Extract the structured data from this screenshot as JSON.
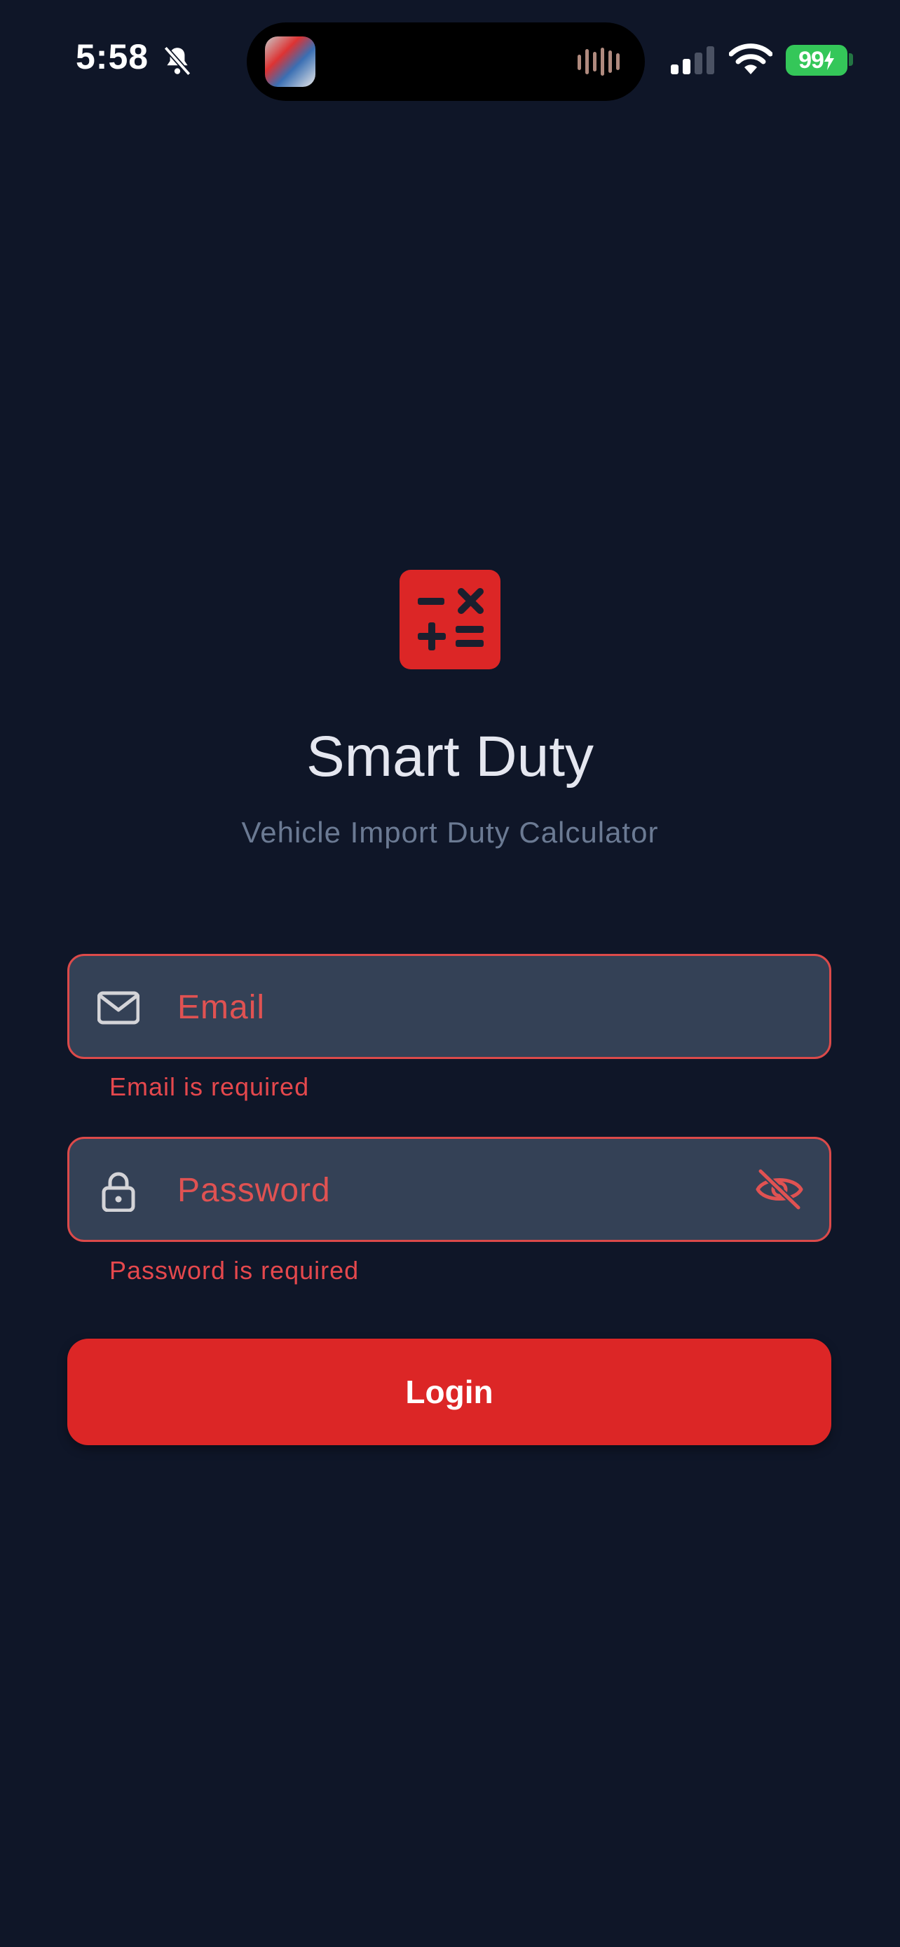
{
  "status_bar": {
    "time": "5:58",
    "battery": "99",
    "icons": [
      "bell-slash-icon",
      "app-thumbnail-icon",
      "audio-wave-icon",
      "cellular-signal-icon",
      "wifi-icon",
      "battery-charging-icon"
    ]
  },
  "app": {
    "logo_icon": "calculator-icon",
    "title": "Smart Duty",
    "subtitle": "Vehicle Import Duty Calculator"
  },
  "form": {
    "email": {
      "icon": "mail-icon",
      "placeholder": "Email",
      "value": "",
      "error": "Email is required"
    },
    "password": {
      "icon": "lock-icon",
      "placeholder": "Password",
      "value": "",
      "toggle_icon": "eye-off-icon",
      "error": "Password is required"
    },
    "login_label": "Login"
  },
  "colors": {
    "background": "#0f1628",
    "accent": "#dc2626",
    "field_background": "#344156",
    "error": "#e5484d",
    "battery": "#34c759"
  }
}
